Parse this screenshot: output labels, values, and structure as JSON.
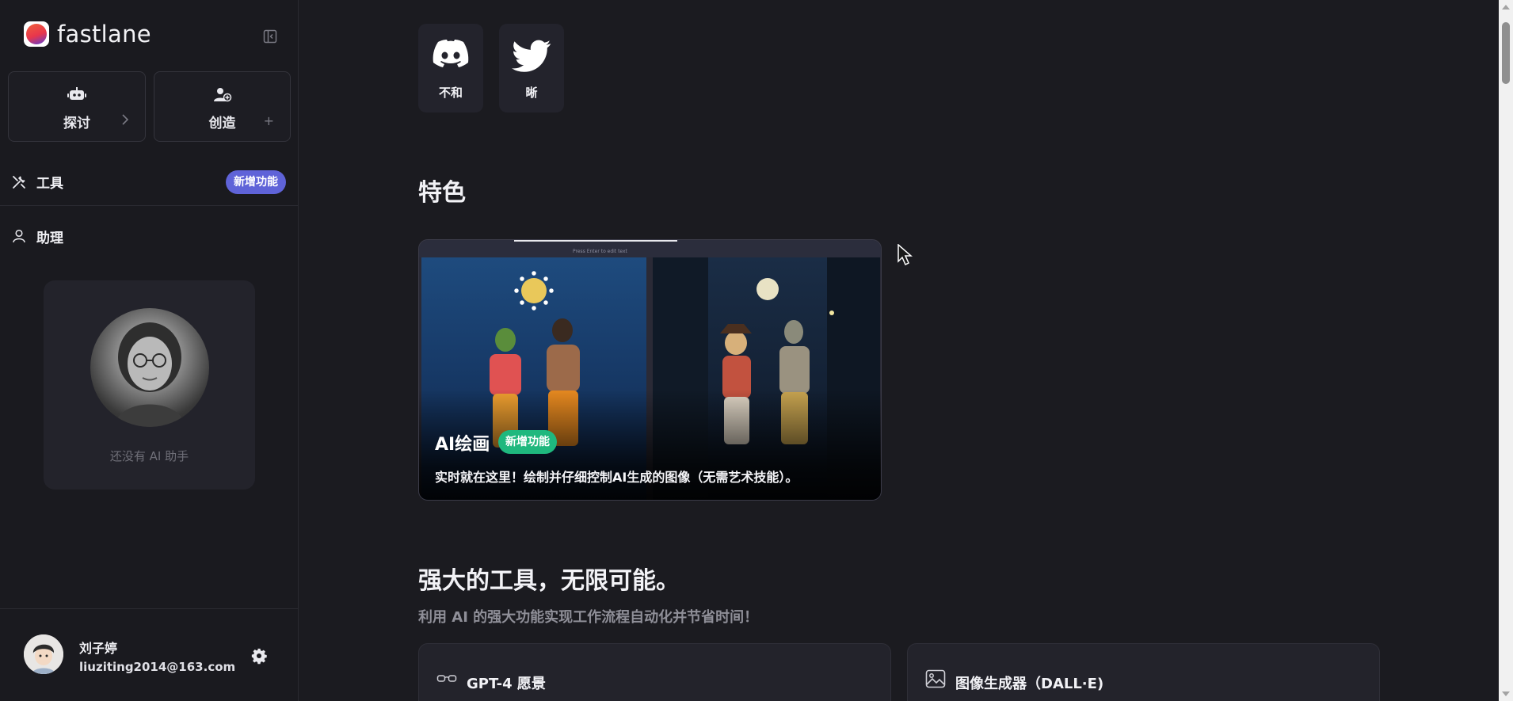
{
  "sidebar": {
    "brand": "fastlane",
    "actions": {
      "explore_label": "探讨",
      "create_label": "创造",
      "create_trail": "+"
    },
    "nav": {
      "tools_label": "工具",
      "tools_badge": "新增功能",
      "assistant_label": "助理"
    },
    "assistant_empty": "还没有 AI 助手",
    "user": {
      "name": "刘子婷",
      "email": "liuziting2014@163.com"
    }
  },
  "main": {
    "social": {
      "discord_label": "不和",
      "twitter_label": "晰"
    },
    "featured": {
      "title": "特色",
      "card": {
        "topbar_text": "Press Enter to edit text",
        "title": "AI绘画",
        "badge": "新增功能",
        "description": "实时就在这里！绘制并仔细控制AI生成的图像（无需艺术技能）。"
      }
    },
    "tools": {
      "title": "强大的工具，无限可能。",
      "subtitle": "利用 AI 的强大功能实现工作流程自动化并节省时间！",
      "cards": [
        {
          "label": "GPT-4 愿景",
          "icon": "glasses-icon"
        },
        {
          "label": "图像生成器（DALL·E)",
          "icon": "image-icon"
        }
      ]
    }
  },
  "colors": {
    "background": "#1b1b20",
    "accent_badge": "#5f63d8",
    "new_badge_green": "#1fb87e"
  }
}
